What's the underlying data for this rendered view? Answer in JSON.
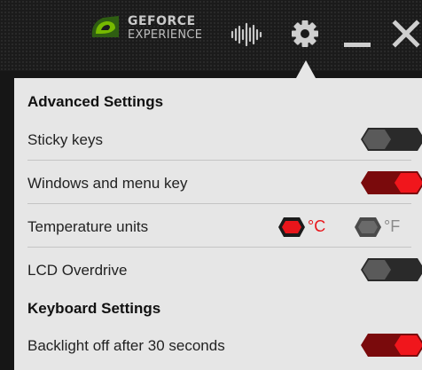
{
  "header": {
    "brand_line1": "GEFORCE",
    "brand_line2": "EXPERIENCE",
    "icons": [
      "nvidia-logo-icon",
      "equalizer-icon",
      "gear-icon",
      "minimize-icon",
      "close-icon"
    ]
  },
  "settings": {
    "advanced_title": "Advanced Settings",
    "sticky_keys_label": "Sticky keys",
    "sticky_keys_on": false,
    "windows_menu_key_label": "Windows and menu key",
    "windows_menu_key_on": true,
    "temperature_units_label": "Temperature units",
    "unit_celsius": "°C",
    "unit_fahrenheit": "°F",
    "selected_unit": "°C",
    "lcd_overdrive_label": "LCD Overdrive",
    "lcd_overdrive_on": false,
    "keyboard_title": "Keyboard Settings",
    "backlight_label": "Backlight off after 30 seconds",
    "backlight_on": true
  },
  "colors": {
    "accent_red": "#e8151b",
    "toggle_off": "#3a3a3a",
    "panel_bg": "#e6e6e6",
    "unit_inactive": "#8a8a8a"
  }
}
